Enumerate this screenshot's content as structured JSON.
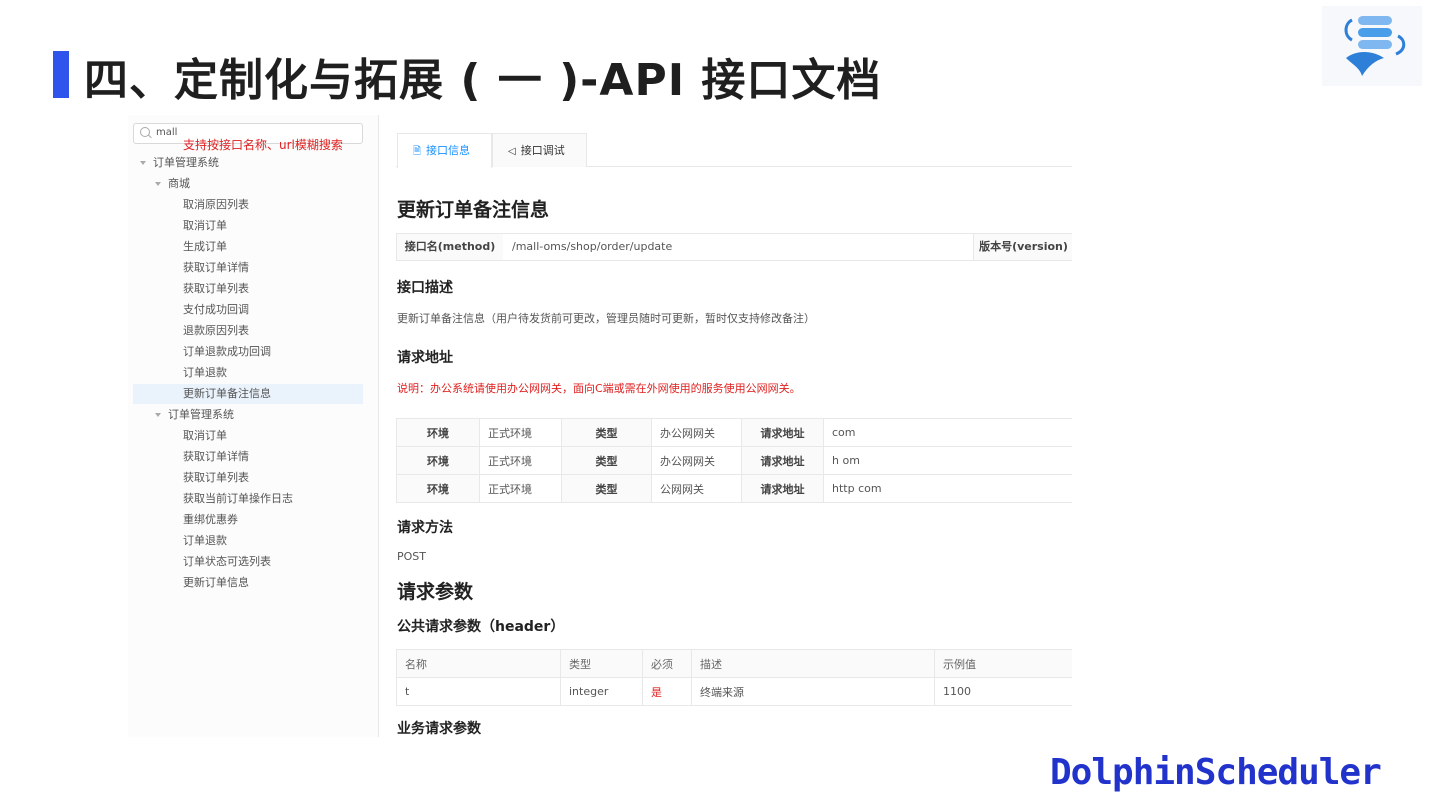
{
  "slide": {
    "title": "四、定制化与拓展 ( 一 )-API 接口文档",
    "brand": "DolphinScheduler"
  },
  "colors": {
    "accent": "#2f54eb",
    "link": "#1890ff",
    "alert": "#e02020",
    "brand": "#2233cc"
  },
  "sidebar": {
    "search_value": "mall",
    "search_hint": "支持按接口名称、url模糊搜索",
    "group1": "订单管理系统",
    "subgroup1": "商城",
    "items1": [
      "取消原因列表",
      "取消订单",
      "生成订单",
      "获取订单详情",
      "获取订单列表",
      "支付成功回调",
      "退款原因列表",
      "订单退款成功回调",
      "订单退款",
      "更新订单备注信息"
    ],
    "group2": "订单管理系统",
    "items2": [
      "取消订单",
      "获取订单详情",
      "获取订单列表",
      "获取当前订单操作日志",
      "重绑优惠券",
      "订单退款",
      "订单状态可选列表",
      "更新订单信息"
    ]
  },
  "tabs": [
    "接口信息",
    "接口调试"
  ],
  "doc": {
    "title": "更新订单备注信息",
    "method_label": "接口名(method)",
    "method_value": "/mall-oms/shop/order/update",
    "version_label": "版本号(version)",
    "desc_heading": "接口描述",
    "desc_text": "更新订单备注信息（用户待发货前可更改，管理员随时可更新，暂时仅支持修改备注）",
    "addr_heading": "请求地址",
    "addr_note": "说明：办公系统请使用办公网网关，面向C端或需在外网使用的服务使用公网网关。",
    "env_rows": [
      [
        "环境",
        "正式环境",
        "类型",
        "办公网网关",
        "请求地址",
        "com"
      ],
      [
        "环境",
        "正式环境",
        "类型",
        "办公网网关",
        "请求地址",
        "h om"
      ],
      [
        "环境",
        "正式环境",
        "类型",
        "公网网关",
        "请求地址",
        "http com"
      ]
    ],
    "method_heading": "请求方法",
    "method_text": "POST",
    "params_heading": "请求参数",
    "header_heading": "公共请求参数（header）",
    "param_columns": [
      "名称",
      "类型",
      "必须",
      "描述",
      "示例值"
    ],
    "param_rows": [
      [
        "t",
        "integer",
        "是",
        "终端来源",
        "1100"
      ]
    ],
    "biz_heading": "业务请求参数"
  }
}
